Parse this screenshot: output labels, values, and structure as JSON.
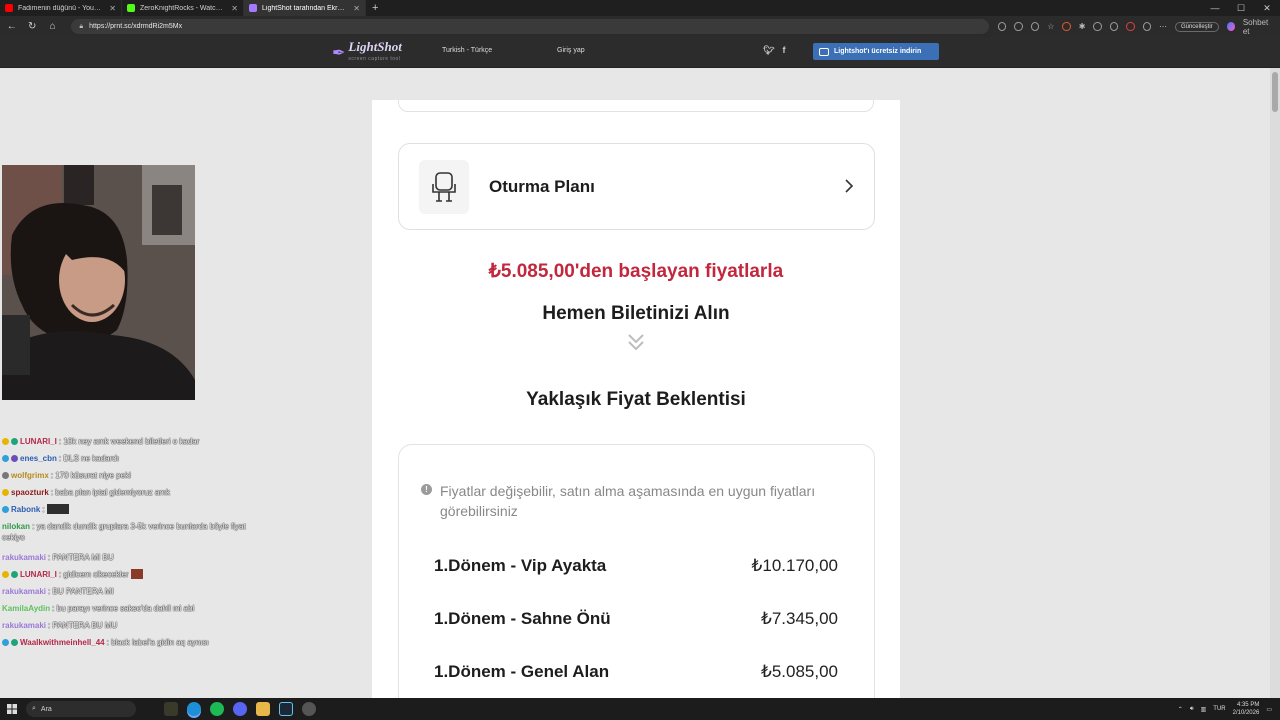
{
  "browser": {
    "tabs": [
      {
        "label": "Fadimenin düğünü - YouTube",
        "color": "#ff0000",
        "active": false
      },
      {
        "label": "ZeroKnightRocks - Watch clips on",
        "color": "#53fc18",
        "active": false
      },
      {
        "label": "LightShot tarafından Ekran Görü",
        "color": "#a779ff",
        "active": true
      }
    ],
    "new_tab": "+",
    "url": "https://prnt.sc/xdrmdRi2m5Mx",
    "update_label": "Güncelleştir",
    "sohbet_label": "Sohbet et"
  },
  "lightshot": {
    "brand": "LightShot",
    "tagline": "screen capture tool",
    "language": "Turkish - Türkçe",
    "login": "Giriş yap",
    "download": "Lightshot'ı ücretsiz indirin"
  },
  "screenshot": {
    "seat_plan": "Oturma Planı",
    "price_from": "₺5.085,00'den başlayan fiyatlarla",
    "get_ticket": "Hemen Biletinizi Alın",
    "expectation_title": "Yaklaşık Fiyat Beklentisi",
    "info_text": "Fiyatlar değişebilir, satın alma aşamasında en uygun fiyatları görebilirsiniz",
    "prices": [
      {
        "name": "1.Dönem - Vip Ayakta",
        "value": "₺10.170,00"
      },
      {
        "name": "1.Dönem - Sahne Önü",
        "value": "₺7.345,00"
      },
      {
        "name": "1.Dönem - Genel Alan",
        "value": "₺5.085,00"
      }
    ]
  },
  "chat": [
    {
      "user": "LUNARI_I",
      "color": "#b3284a",
      "text": ": 10k ney amk weekend biletleri o kadar"
    },
    {
      "user": "enes_cbn",
      "color": "#2a5db3",
      "text": ": DLS ne kadardı"
    },
    {
      "user": "wolfgrimx",
      "color": "#b38c1f",
      "text": ": 170 küsurat niye peki"
    },
    {
      "user": "spaozturk",
      "color": "#8a1a1a",
      "text": ": baba plan iptal gidemiyoruz amk"
    },
    {
      "user": "Rabonk",
      "color": "#2a5db3",
      "text": ":",
      "emote": true
    },
    {
      "user": "nilokan",
      "color": "#2e9a4b",
      "text": ": ya dandik dundik gruplara 3-5k verince bunlarda böyle fiyat cekiyo",
      "wrap": true
    },
    {
      "user": "rakukamaki",
      "color": "#9a7ad6",
      "text": ": PANTERA MI BU"
    },
    {
      "user": "LUNARI_I",
      "color": "#b3284a",
      "text": ": gidicem cikecekler",
      "emote_red": true
    },
    {
      "user": "rakukamaki",
      "color": "#9a7ad6",
      "text": ": BU PANTERA MI"
    },
    {
      "user": "KamilaAydin",
      "color": "#5cc25c",
      "text": ": bu parayı verince sakso'da dahil mi abi"
    },
    {
      "user": "rakukamaki",
      "color": "#9a7ad6",
      "text": ": PANTERA BU MU"
    },
    {
      "user": "Waalkwithmeinhell_44",
      "color": "#b3284a",
      "text": ": black label'a gidin aq aynısı"
    }
  ],
  "taskbar": {
    "search": "Ara",
    "lang": "TUR",
    "time": "4:35 PM",
    "date": "2/10/2026"
  }
}
